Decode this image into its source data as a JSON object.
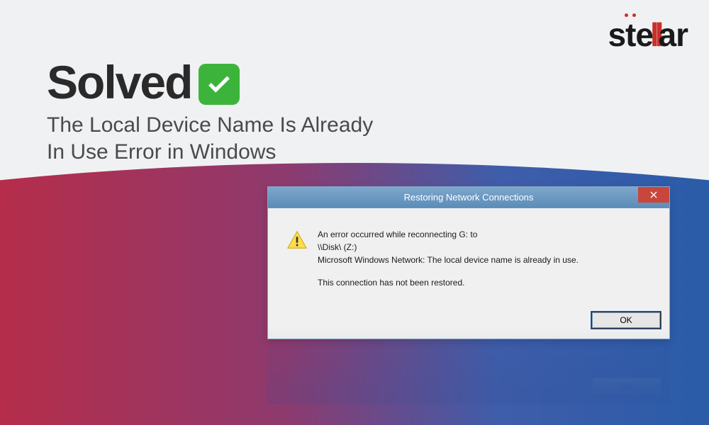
{
  "brand": {
    "name": "stellar"
  },
  "headline": {
    "solved": "Solved",
    "subtitle_line1": "The Local Device Name Is Already",
    "subtitle_line2": "In Use Error in Windows"
  },
  "dialog": {
    "title": "Restoring Network Connections",
    "message_line1": "An error occurred while reconnecting G: to",
    "message_line2": "\\\\Disk\\ (Z:)",
    "message_line3": "Microsoft Windows Network: The local device name is already in use.",
    "message_line4": "This connection has not been restored.",
    "ok_label": "OK"
  }
}
